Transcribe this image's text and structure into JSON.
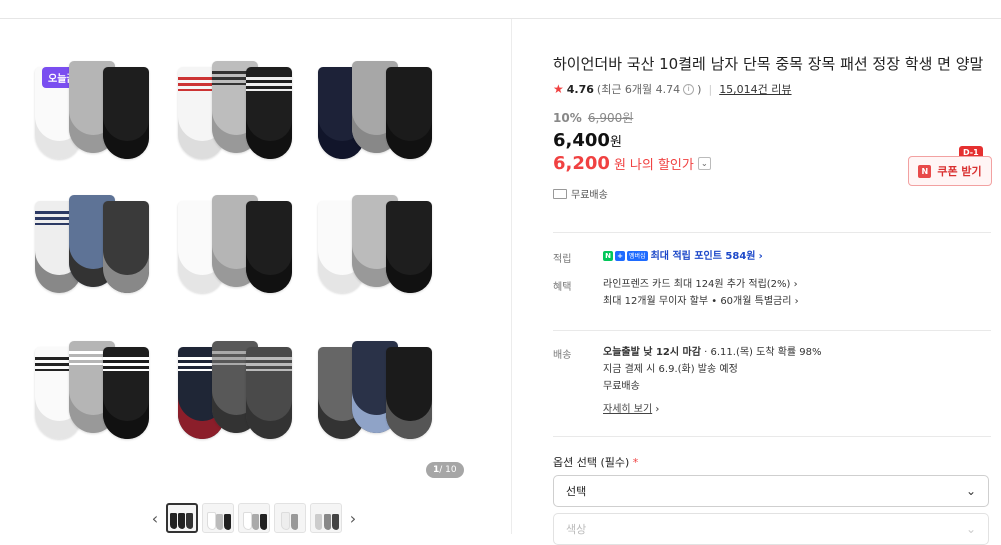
{
  "gallery": {
    "badge": "오늘끝딜",
    "counter_current": "1",
    "counter_total": "/ 10",
    "prev_arrow": "‹",
    "next_arrow": "›",
    "thumb_count": 5
  },
  "product": {
    "title": "하이언더바 국산 10켤레 남자 단목 중목 장목 패션 정장 학생 면 양말",
    "rating": "4.76",
    "rating_recent": "(최근 6개월 4.74",
    "rating_recent_close": ")",
    "review_count": "15,014건 리뷰",
    "discount_rate": "10%",
    "original_price": "6,900원",
    "price": "6,400",
    "price_unit": "원",
    "my_price": "6,200",
    "my_price_unit": "원",
    "my_price_label": "나의 할인가",
    "shipping_free": "무료배송"
  },
  "coupon": {
    "label": "쿠폰 받기",
    "dday": "D-1",
    "icon_letter": "N"
  },
  "info": {
    "points_key": "적립",
    "points_text": "최대 적립 포인트 584원",
    "benefit_key": "혜택",
    "benefit_line1": "라인프렌즈 카드 최대 124원 추가 적립(2%)",
    "benefit_line2": "최대 12개월 무이자 할부 • 60개월 특별금리",
    "delivery_key": "배송",
    "delivery_line1_bold": "오늘출발 낮 12시 마감",
    "delivery_line1_rest": "· 6.11.(목) 도착 확률 98%",
    "delivery_line2": "지금 결제 시 6.9.(화) 발송 예정",
    "delivery_line3": "무료배송",
    "detail_link": "자세히 보기"
  },
  "options": {
    "label": "옵션 선택 (필수)",
    "required_mark": "*",
    "select1": "선택",
    "select2": "색상"
  },
  "colors": {
    "accent_red": "#f04141",
    "badge_purple": "#7a4ef0",
    "naver_green": "#03c75a"
  }
}
